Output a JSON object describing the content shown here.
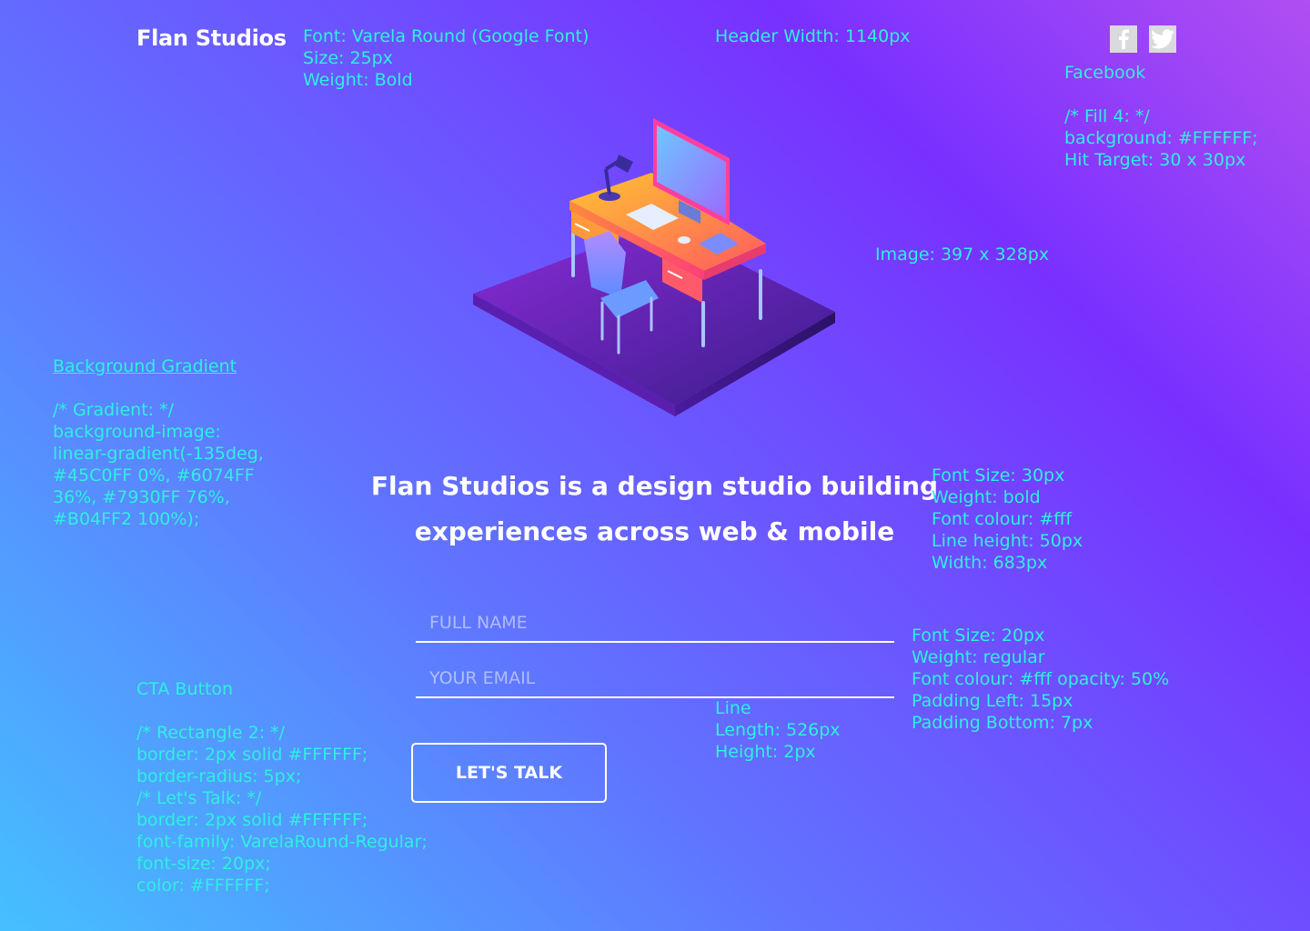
{
  "header": {
    "logo": "Flan Studios",
    "font_note": "Font: Varela Round (Google Font)\nSize: 25px\nWeight: Bold",
    "width_note": "Header Width: 1140px"
  },
  "social": {
    "facebook_icon": "facebook-icon",
    "twitter_icon": "twitter-icon",
    "facebook_note_title": "Facebook",
    "facebook_note_body": "/* Fill 4: */\nbackground: #FFFFFF;\nHit Target: 30 x 30px"
  },
  "image": {
    "note": "Image: 397 x 328px"
  },
  "background": {
    "note_title": "Background Gradient",
    "note_body": "/* Gradient: */\nbackground-image:\nlinear-gradient(-135deg,\n#45C0FF 0%, #6074FF\n36%, #7930FF 76%,\n#B04FF2 100%);",
    "colors": [
      "#45C0FF",
      "#6074FF",
      "#7930FF",
      "#B04FF2"
    ]
  },
  "hero": {
    "headline": "Flan Studios is a design studio building experiences across web & mobile",
    "note": "Font Size: 30px\nWeight: bold\nFont colour: #fff\nLine height: 50px\nWidth: 683px"
  },
  "form": {
    "name_placeholder": "FULL NAME",
    "email_placeholder": "YOUR EMAIL",
    "input_note": "Font Size: 20px\nWeight: regular\nFont colour: #fff opacity: 50%\nPadding Left: 15px\nPadding Bottom: 7px",
    "line_note": "Line\nLength: 526px\nHeight: 2px"
  },
  "cta": {
    "label": "LET'S TALK",
    "note_title": "CTA Button",
    "note_body": "/* Rectangle 2: */\nborder: 2px solid #FFFFFF;\nborder-radius: 5px;\n/* Let's Talk: */\nborder: 2px solid #FFFFFF;\nfont-family: VarelaRound-Regular;\nfont-size: 20px;\ncolor: #FFFFFF;"
  },
  "colors": {
    "annotation": "#2EF0E0",
    "text": "#FFFFFF"
  }
}
